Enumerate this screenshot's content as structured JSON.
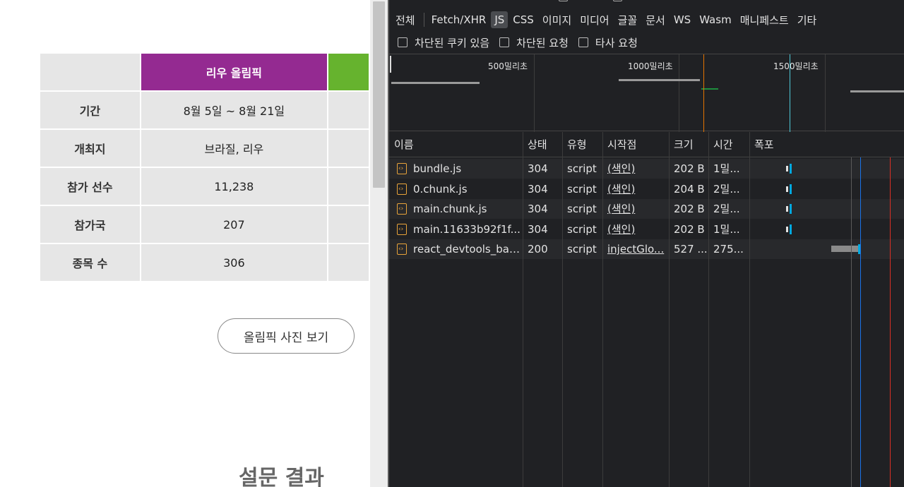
{
  "webpage": {
    "table": {
      "header": {
        "corner": "",
        "rio": "리우 올림픽",
        "next": ""
      },
      "rows": [
        {
          "label": "기간",
          "rio": "8월 5일 ~ 8월 21일"
        },
        {
          "label": "개최지",
          "rio": "브라질, 리우"
        },
        {
          "label": "참가 선수",
          "rio": "11,238"
        },
        {
          "label": "참가국",
          "rio": "207"
        },
        {
          "label": "종목 수",
          "rio": "306"
        }
      ]
    },
    "photo_button": "올림픽 사진 보기",
    "survey_heading": "설문 결과",
    "colors": {
      "rio_header": "#942a91",
      "next_header": "#66b32e"
    }
  },
  "devtools": {
    "filter_types": [
      "전체",
      "Fetch/XHR",
      "JS",
      "CSS",
      "이미지",
      "미디어",
      "글꼴",
      "문서",
      "WS",
      "Wasm",
      "매니페스트",
      "기타"
    ],
    "active_filter": "JS",
    "checkboxes": [
      "차단된 쿠키 있음",
      "차단된 요청",
      "타사 요청"
    ],
    "timeline_labels": [
      "500밀리초",
      "1000밀리초",
      "1500밀리초"
    ],
    "columns": [
      "이름",
      "상태",
      "유형",
      "시작점",
      "크기",
      "시간",
      "폭포"
    ],
    "requests": [
      {
        "name": "bundle.js",
        "status": "304",
        "type": "script",
        "initiator": "(색인)",
        "size": "202 B",
        "time": "1밀..."
      },
      {
        "name": "0.chunk.js",
        "status": "304",
        "type": "script",
        "initiator": "(색인)",
        "size": "204 B",
        "time": "2밀..."
      },
      {
        "name": "main.chunk.js",
        "status": "304",
        "type": "script",
        "initiator": "(색인)",
        "size": "202 B",
        "time": "2밀..."
      },
      {
        "name": "main.11633b92f1f...",
        "status": "304",
        "type": "script",
        "initiator": "(색인)",
        "size": "202 B",
        "time": "1밀..."
      },
      {
        "name": "react_devtools_bac...",
        "status": "200",
        "type": "script",
        "initiator": "injectGlo...",
        "size": "527 ...",
        "time": "275..."
      }
    ],
    "colors": {
      "dcl_line": "#1a73e8",
      "load_line": "#d93025",
      "waterfall_bar": "#00a9e0"
    }
  }
}
